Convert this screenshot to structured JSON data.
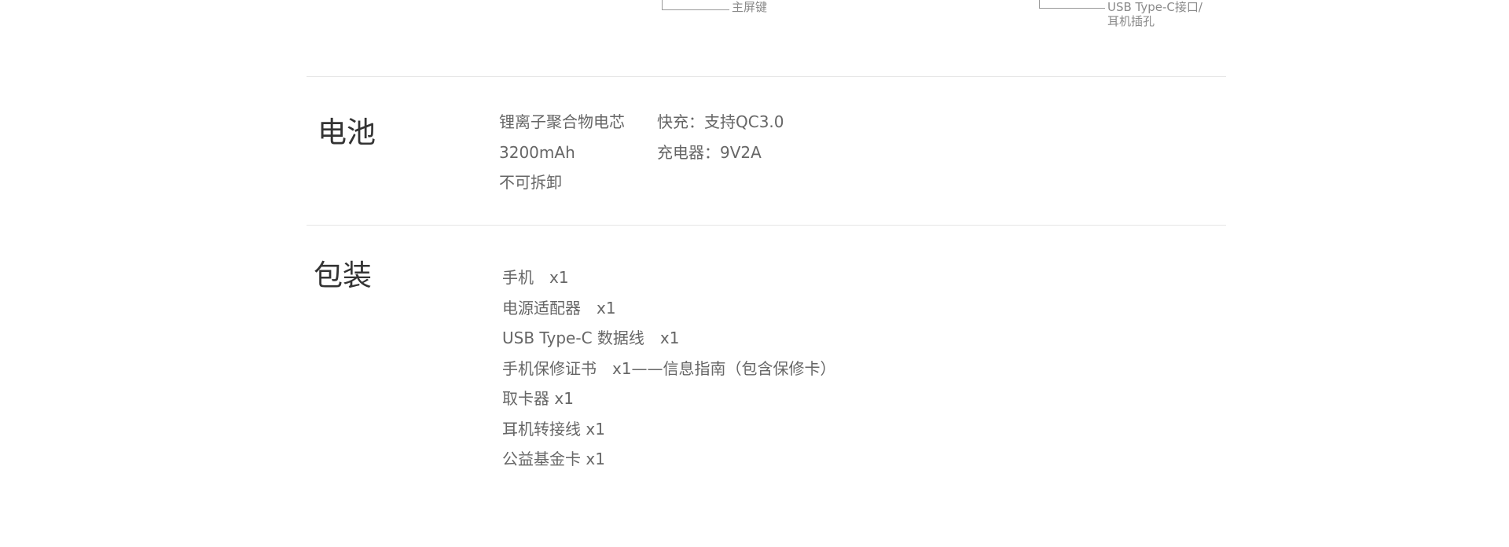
{
  "diagram": {
    "home_key_label": "主屏键",
    "port_label_line1": "USB Type-C接口/",
    "port_label_line2": "耳机插孔"
  },
  "battery": {
    "title": "电池",
    "col1": [
      "锂离子聚合物电芯",
      "3200mAh",
      "不可拆卸"
    ],
    "col2": [
      "快充：支持QC3.0",
      "充电器：9V2A"
    ]
  },
  "packaging": {
    "title": "包装",
    "items": [
      "手机　x1",
      "电源适配器　x1",
      "USB Type-C 数据线　x1",
      "手机保修证书　x1——信息指南（包含保修卡）",
      "取卡器 x1",
      "耳机转接线 x1",
      "公益基金卡 x1"
    ]
  }
}
